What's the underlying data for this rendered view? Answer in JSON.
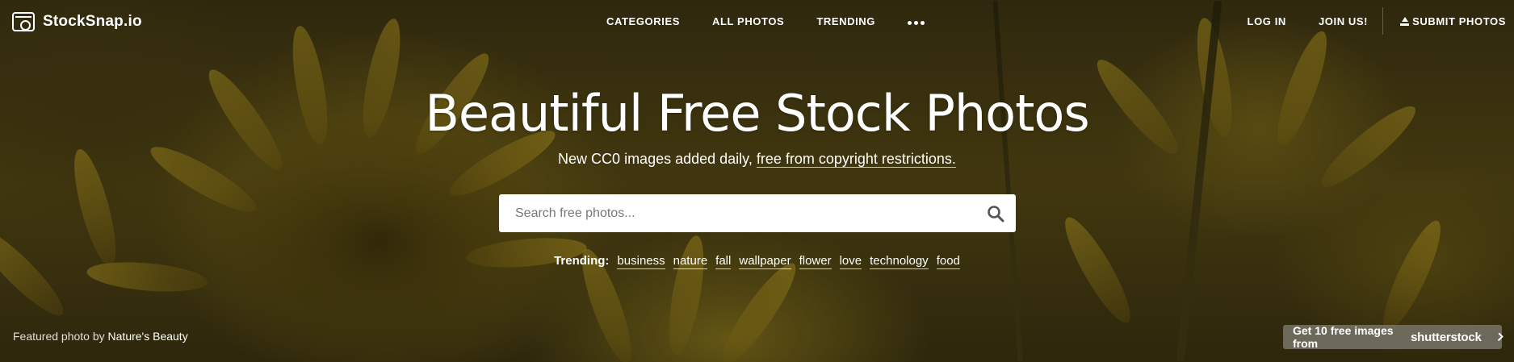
{
  "brand": {
    "name": "StockSnap.io"
  },
  "nav": {
    "center": [
      "CATEGORIES",
      "ALL PHOTOS",
      "TRENDING"
    ],
    "more_icon": "ellipsis-icon",
    "login": "LOG IN",
    "join": "JOIN US!",
    "submit": "SUBMIT PHOTOS"
  },
  "hero": {
    "headline": "Beautiful Free Stock Photos",
    "sub_prefix": "New CC0 images added daily,",
    "sub_link": "free from copyright restrictions."
  },
  "search": {
    "placeholder": "Search free photos..."
  },
  "trending": {
    "label": "Trending:",
    "tags": [
      "business",
      "nature",
      "fall",
      "wallpaper",
      "flower",
      "love",
      "technology",
      "food"
    ]
  },
  "featured": {
    "prefix": "Featured photo by",
    "author": "Nature's Beauty"
  },
  "promo": {
    "text": "Get 10 free images from",
    "brand": "shutterstock"
  },
  "colors": {
    "overlay": "#3a3212",
    "promo_bg": "#78746a",
    "text": "#ffffff"
  }
}
